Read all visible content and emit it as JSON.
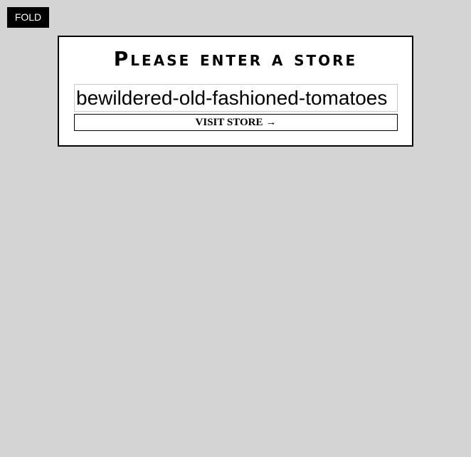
{
  "fold_button": {
    "label": "FOLD"
  },
  "store_card": {
    "title": "Please enter a store",
    "input": {
      "value": "bewildered-old-fashioned-tomatoes",
      "placeholder": ""
    },
    "visit_button": {
      "label": "VISIT STORE",
      "icon": "arrow-right-icon",
      "icon_glyph": "→"
    }
  },
  "colors": {
    "background": "#d4d4d4",
    "card": "#ffffff",
    "border": "#000000",
    "fold_bg": "#000000",
    "fold_text": "#ffffff"
  }
}
